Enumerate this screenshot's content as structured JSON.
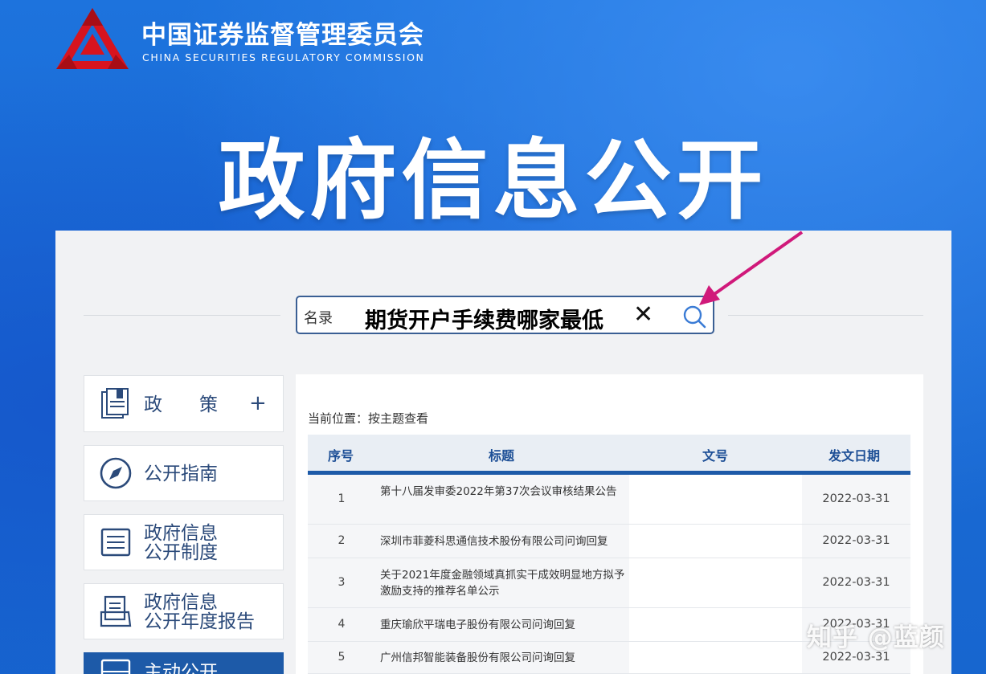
{
  "header": {
    "org_name_cn": "中国证券监督管理委员会",
    "org_name_en": "CHINA SECURITIES REGULATORY COMMISSION",
    "logo_icon": "csrc-logo-icon",
    "brand_red": "#d7141f"
  },
  "hero": {
    "title": "政府信息公开"
  },
  "search": {
    "placeholder": "名录",
    "value": "期货开户手续费哪家最低",
    "clear_icon": "close-icon",
    "search_icon": "search-icon"
  },
  "annotation": {
    "arrow_color": "#d0197a"
  },
  "sidebar": {
    "items": [
      {
        "label": "政　　策",
        "suffix": "+",
        "icon": "document-icon"
      },
      {
        "label": "公开指南",
        "icon": "compass-icon"
      },
      {
        "label_line1": "政府信息",
        "label_line2": "公开制度",
        "icon": "list-icon"
      },
      {
        "label_line1": "政府信息",
        "label_line2": "公开年度报告",
        "icon": "report-icon"
      },
      {
        "label": "主动公开",
        "icon": "inbox-icon"
      }
    ]
  },
  "breadcrumb": {
    "text": "当前位置：按主题查看"
  },
  "table": {
    "headers": [
      "序号",
      "标题",
      "文号",
      "发文日期"
    ],
    "rows": [
      {
        "num": "1",
        "title": "第十八届发审委2022年第37次会议审核结果公告",
        "docno": "",
        "date": "2022-03-31"
      },
      {
        "num": "2",
        "title": "深圳市菲菱科思通信技术股份有限公司问询回复",
        "docno": "",
        "date": "2022-03-31"
      },
      {
        "num": "3",
        "title": "关于2021年度金融领域真抓实干成效明显地方拟予激励支持的推荐名单公示",
        "docno": "",
        "date": "2022-03-31"
      },
      {
        "num": "4",
        "title": "重庆瑜欣平瑞电子股份有限公司问询回复",
        "docno": "",
        "date": "2022-03-31"
      },
      {
        "num": "5",
        "title": "广州信邦智能装备股份有限公司问询回复",
        "docno": "",
        "date": "2022-03-31"
      }
    ]
  },
  "watermark": {
    "text": "知乎 @蓝颜"
  }
}
